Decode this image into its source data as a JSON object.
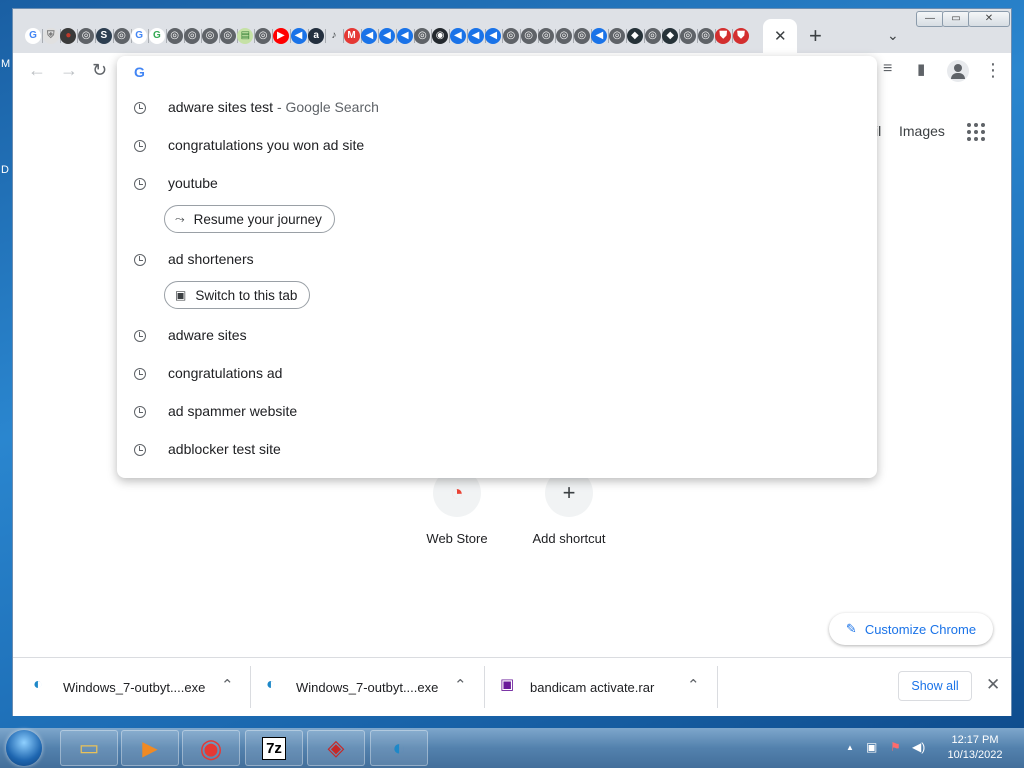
{
  "desktop": {
    "left_letters": [
      "M",
      "D"
    ]
  },
  "tabs": {
    "favicons": [
      {
        "glyph": "G",
        "color": "#4285f4",
        "bg": "#ffffff"
      },
      {
        "glyph": "⛨",
        "color": "#7a7a7a",
        "bg": "#e0e0e0"
      },
      {
        "glyph": "●",
        "color": "#c0392b",
        "bg": "#3a3a3a"
      },
      {
        "glyph": "◎",
        "color": "#ffffff",
        "bg": "#5f6368"
      },
      {
        "glyph": "S",
        "color": "#ffffff",
        "bg": "#2c3e50"
      },
      {
        "glyph": "◎",
        "color": "#ffffff",
        "bg": "#5f6368"
      },
      {
        "glyph": "G",
        "color": "#4285f4",
        "bg": "#ffffff"
      },
      {
        "glyph": "G",
        "color": "#34a853",
        "bg": "#ffffff"
      },
      {
        "glyph": "◎",
        "color": "#ffffff",
        "bg": "#5f6368"
      },
      {
        "glyph": "◎",
        "color": "#ffffff",
        "bg": "#5f6368"
      },
      {
        "glyph": "◎",
        "color": "#ffffff",
        "bg": "#5f6368"
      },
      {
        "glyph": "◎",
        "color": "#ffffff",
        "bg": "#5f6368"
      },
      {
        "glyph": "▤",
        "color": "#2e7d32",
        "bg": "#c5e1a5"
      },
      {
        "glyph": "◎",
        "color": "#ffffff",
        "bg": "#5f6368"
      },
      {
        "glyph": "▶",
        "color": "#ffffff",
        "bg": "#ff0000"
      },
      {
        "glyph": "◀",
        "color": "#ffffff",
        "bg": "#1a73e8"
      },
      {
        "glyph": "a",
        "color": "#ffffff",
        "bg": "#232f3e"
      },
      {
        "glyph": "♪",
        "color": "#3c4043",
        "bg": "#dee1e6"
      },
      {
        "glyph": "M",
        "color": "#ffffff",
        "bg": "#e53935"
      },
      {
        "glyph": "◀",
        "color": "#ffffff",
        "bg": "#1a73e8"
      },
      {
        "glyph": "◀",
        "color": "#ffffff",
        "bg": "#1a73e8"
      },
      {
        "glyph": "◀",
        "color": "#ffffff",
        "bg": "#1a73e8"
      },
      {
        "glyph": "◎",
        "color": "#ffffff",
        "bg": "#5f6368"
      },
      {
        "glyph": "◉",
        "color": "#ffffff",
        "bg": "#24292e"
      },
      {
        "glyph": "◀",
        "color": "#ffffff",
        "bg": "#1a73e8"
      },
      {
        "glyph": "◀",
        "color": "#ffffff",
        "bg": "#1a73e8"
      },
      {
        "glyph": "◀",
        "color": "#ffffff",
        "bg": "#1a73e8"
      },
      {
        "glyph": "◎",
        "color": "#ffffff",
        "bg": "#5f6368"
      },
      {
        "glyph": "◎",
        "color": "#ffffff",
        "bg": "#5f6368"
      },
      {
        "glyph": "◎",
        "color": "#ffffff",
        "bg": "#5f6368"
      },
      {
        "glyph": "◎",
        "color": "#ffffff",
        "bg": "#5f6368"
      },
      {
        "glyph": "◎",
        "color": "#ffffff",
        "bg": "#5f6368"
      },
      {
        "glyph": "◀",
        "color": "#ffffff",
        "bg": "#1a73e8"
      },
      {
        "glyph": "◎",
        "color": "#ffffff",
        "bg": "#5f6368"
      },
      {
        "glyph": "◆",
        "color": "#ffffff",
        "bg": "#263238"
      },
      {
        "glyph": "◎",
        "color": "#ffffff",
        "bg": "#5f6368"
      },
      {
        "glyph": "◆",
        "color": "#ffffff",
        "bg": "#263238"
      },
      {
        "glyph": "◎",
        "color": "#ffffff",
        "bg": "#5f6368"
      },
      {
        "glyph": "◎",
        "color": "#ffffff",
        "bg": "#5f6368"
      },
      {
        "glyph": "⛊",
        "color": "#ffffff",
        "bg": "#d32f2f"
      },
      {
        "glyph": "⛊",
        "color": "#ffffff",
        "bg": "#d32f2f"
      }
    ],
    "active_close": "✕",
    "new_tab": "+",
    "tab_search": "⌄"
  },
  "window_controls": {
    "minimize": "—",
    "maximize": "▭",
    "close": "✕"
  },
  "toolbar": {
    "back": "←",
    "forward": "→",
    "reload": "↻",
    "reading_list": "≡",
    "side_panel": "▮",
    "menu": "⋮"
  },
  "page": {
    "top_links": {
      "gmail_partial": "il",
      "images": "Images"
    },
    "shortcuts": [
      {
        "label": "Web Store",
        "icon": "◔"
      },
      {
        "label": "Add shortcut",
        "icon": "+"
      }
    ],
    "customize_label": "Customize Chrome",
    "customize_icon": "✎"
  },
  "omnibox": {
    "provider_icon": "G",
    "suggestions": [
      {
        "text": "adware sites test",
        "sub": " - Google Search"
      },
      {
        "text": "congratulations you won ad site",
        "sub": ""
      },
      {
        "text": "youtube",
        "sub": ""
      },
      {
        "text": "ad shorteners",
        "sub": ""
      },
      {
        "text": "adware sites",
        "sub": ""
      },
      {
        "text": "congratulations ad",
        "sub": ""
      },
      {
        "text": "ad spammer website",
        "sub": ""
      },
      {
        "text": "adblocker test site",
        "sub": ""
      }
    ],
    "chips": {
      "resume": {
        "label": "Resume your journey",
        "icon": "⤳"
      },
      "switch": {
        "label": "Switch to this tab",
        "icon": "▣"
      }
    }
  },
  "downloads": {
    "items": [
      {
        "name": "Windows_7-outbyt....exe",
        "icon": "◐",
        "icon_color": "#1e88c8"
      },
      {
        "name": "Windows_7-outbyt....exe",
        "icon": "◐",
        "icon_color": "#1e88c8"
      },
      {
        "name": "bandicam activate.rar",
        "icon": "▣",
        "icon_color": "#6a1b9a"
      }
    ],
    "expand_icon": "⌃",
    "show_all": "Show all",
    "close": "✕"
  },
  "taskbar": {
    "apps": [
      {
        "name": "explorer",
        "glyph": "▭",
        "color": "#e8c15a"
      },
      {
        "name": "media-player",
        "glyph": "▶",
        "color": "#f08a24"
      },
      {
        "name": "chrome",
        "glyph": "◉",
        "color": "#e53935"
      },
      {
        "name": "7-zip",
        "glyph": "7z",
        "color": "#000000"
      },
      {
        "name": "installer",
        "glyph": "◈",
        "color": "#c62828"
      },
      {
        "name": "outbyte",
        "glyph": "◐",
        "color": "#1e88c8"
      }
    ],
    "tray": {
      "arrow": "▲",
      "network": "▣",
      "flag": "⚑",
      "volume": "◀)"
    },
    "time": "12:17 PM",
    "date": "10/13/2022"
  }
}
